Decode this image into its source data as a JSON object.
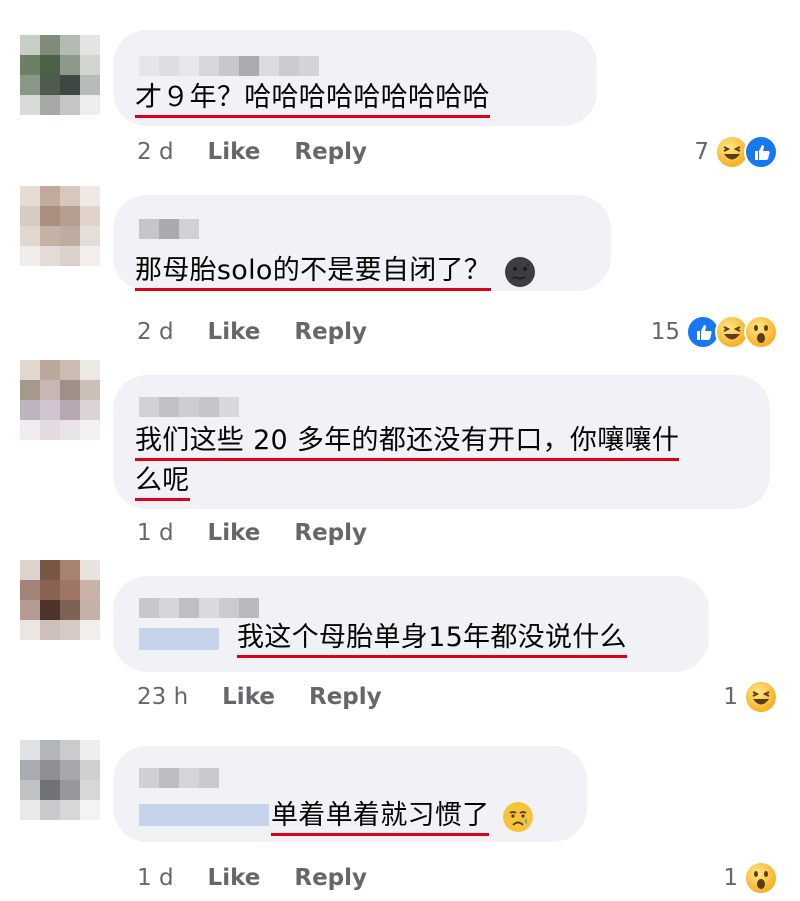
{
  "comments": [
    {
      "text": "才９年？哈哈哈哈哈哈哈哈哈",
      "time": "2 d",
      "like_label": "Like",
      "reply_label": "Reply",
      "reaction_count": "7",
      "reactions": [
        "haha-icon",
        "like-icon"
      ]
    },
    {
      "text": "那母胎solo的不是要自闭了？",
      "emoji": "new-moon-face-emoji",
      "time": "2 d",
      "like_label": "Like",
      "reply_label": "Reply",
      "reaction_count": "15",
      "reactions": [
        "like-icon",
        "haha-icon",
        "wow-icon"
      ]
    },
    {
      "text_line1": "我们这些 20 多年的都还没有开口，你嚷嚷什",
      "text_line2": "么呢",
      "time": "1 d",
      "like_label": "Like",
      "reply_label": "Reply"
    },
    {
      "text": "我这个母胎单身15年都没说什么",
      "time": "23 h",
      "like_label": "Like",
      "reply_label": "Reply",
      "reaction_count": "1",
      "reactions": [
        "haha-icon"
      ]
    },
    {
      "text": "单着单着就习惯了",
      "emoji": "crying-face-emoji",
      "time": "1 d",
      "like_label": "Like",
      "reply_label": "Reply",
      "reaction_count": "1",
      "reactions": [
        "wow-icon"
      ]
    }
  ],
  "colors": {
    "bubble": "#f0f2f5",
    "underline": "#e0001b",
    "meta_text": "#65676b",
    "like_blue": "#1877f2"
  }
}
